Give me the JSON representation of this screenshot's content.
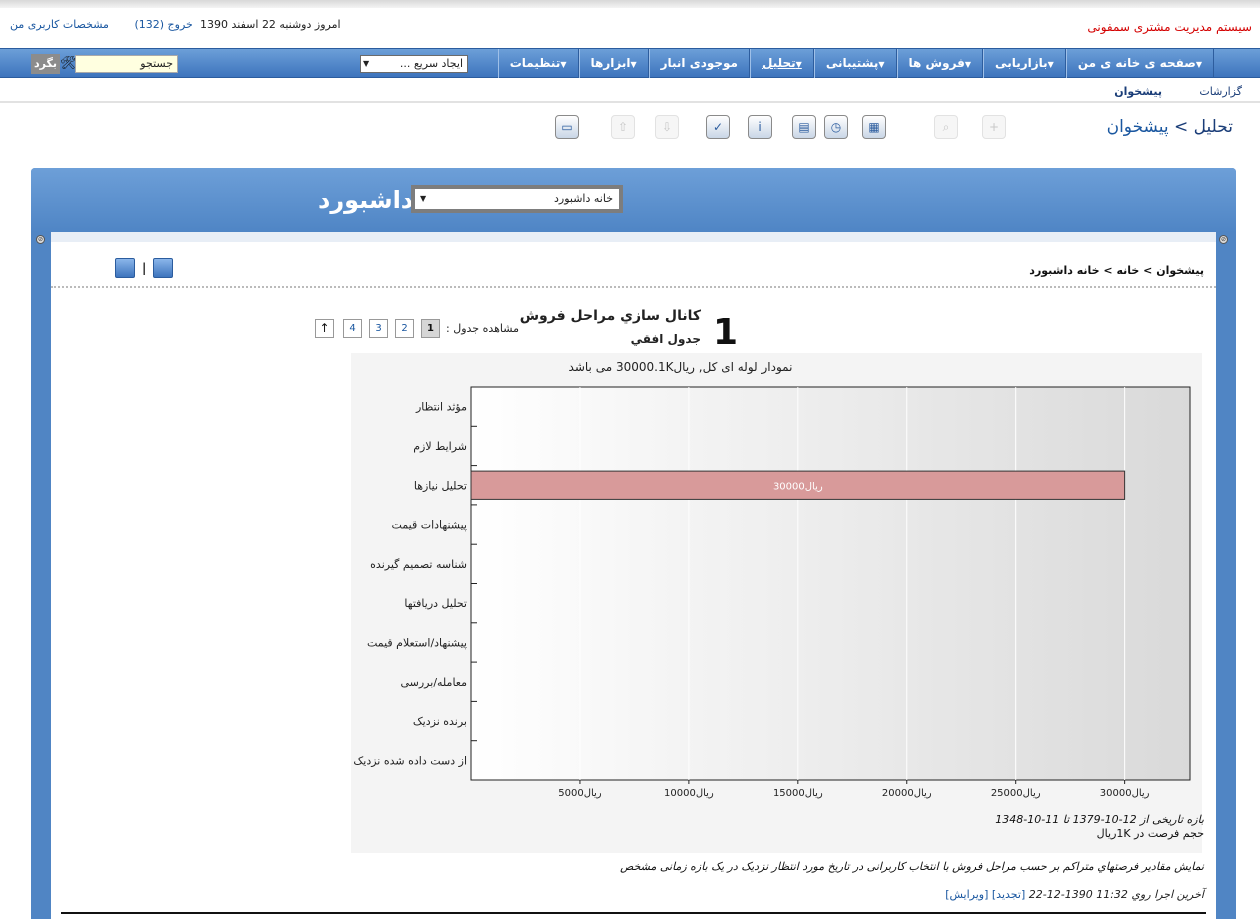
{
  "header": {
    "brand": "سیستم مدیریت مشتری سمفونی",
    "date_text": "امروز دوشنبه 22 اسفند 1390",
    "user_profile": "مشخصات کاربری من",
    "logout": "خروج (132)"
  },
  "menu": [
    {
      "label": "صفحه ی خانه ی من",
      "arrow": true
    },
    {
      "label": "بازاریابی",
      "arrow": true
    },
    {
      "label": "فروش ها",
      "arrow": true
    },
    {
      "label": "پشتیبانی",
      "arrow": true
    },
    {
      "label": "تحلیل",
      "arrow": true,
      "active": true
    },
    {
      "label": "موجودی انبار",
      "arrow": false
    },
    {
      "label": "ابزارها",
      "arrow": true
    },
    {
      "label": "تنظیمات",
      "arrow": true
    }
  ],
  "quick_create": "ایجاد سریع ...",
  "search": {
    "placeholder": "جستجو",
    "go": "بگرد"
  },
  "subnav": {
    "reports": "گزارشات",
    "dashboard": "پیشخوان"
  },
  "page_title": {
    "section": "تحلیل",
    "sep": ">",
    "current": "پیشخوان"
  },
  "toolbar_icons": [
    {
      "name": "add-icon",
      "glyph": "+",
      "enabled": false
    },
    {
      "name": "search-icon",
      "glyph": "⌕",
      "enabled": false
    },
    {
      "name": "calendar-icon",
      "glyph": "▦",
      "enabled": true
    },
    {
      "name": "clock-icon",
      "glyph": "◷",
      "enabled": true
    },
    {
      "name": "calculator-icon",
      "glyph": "▤",
      "enabled": true
    },
    {
      "name": "chat-icon",
      "glyph": "i",
      "enabled": true
    },
    {
      "name": "clipboard-icon",
      "glyph": "✓",
      "enabled": true
    },
    {
      "name": "import-icon",
      "glyph": "⇩",
      "enabled": false
    },
    {
      "name": "export-icon",
      "glyph": "⇧",
      "enabled": false
    },
    {
      "name": "monitor-icon",
      "glyph": "▭",
      "enabled": true
    }
  ],
  "dashboard": {
    "title": "داشبورد",
    "selector": "خانه داشبورد",
    "breadcrumb": "پیشخوان > خانه > خانه داشبورد",
    "widget": {
      "number": "1",
      "title": "كانال سازي مراحل فروش",
      "subtitle": "جدول افقي",
      "pager_label": "مشاهده جدول :",
      "pages": [
        "1",
        "2",
        "3",
        "4"
      ],
      "up": "↑"
    },
    "range_text": "بازه تاریخی از 12-10-1379 تا 11-10-1348",
    "unit_text": "حجم فرصت در 1Kریال",
    "description": "نمایش مقادیر فرصتهاي متراکم بر حسب مراحل فروش با انتخاب کاربرانی در تاریخ مورد انتظار نزدیک در یک بازه زمانی مشخص",
    "last_run": "آخرین اجرا روي 11:32 1390-12-22",
    "refresh": "[تجدید]",
    "edit": "[ویرایش]"
  },
  "chart_data": {
    "type": "bar",
    "orientation": "horizontal",
    "title": "نمودار لوله ای کل, ریال30000.1K می باشد",
    "categories": [
      "مؤثد انتظار",
      "شرایط لازم",
      "تحلیل نیازها",
      "پیشنهادات قیمت",
      "شناسه تصمیم گیرنده",
      "تحلیل دریافتها",
      "پیشنهاد/استعلام قیمت",
      "معامله/بررسی",
      "برنده نزدیک",
      "از دست داده شده نزدیک"
    ],
    "values": [
      0,
      0,
      30000,
      0,
      0,
      0,
      0,
      0,
      0,
      0
    ],
    "value_labels": [
      "",
      "",
      "30000ریال",
      "",
      "",
      "",
      "",
      "",
      "",
      ""
    ],
    "xlim": [
      0,
      33000
    ],
    "ticks": [
      5000,
      10000,
      15000,
      20000,
      25000,
      30000
    ],
    "tick_labels": [
      "5000ریال",
      "10000ریال",
      "15000ریال",
      "20000ریال",
      "25000ریال",
      "30000ریال"
    ],
    "grid": true,
    "bar_color": "#d89a9a"
  }
}
